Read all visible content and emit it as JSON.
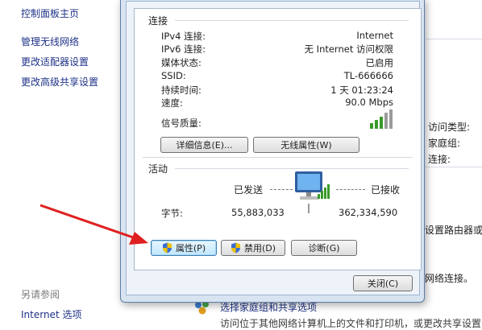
{
  "control_panel": {
    "home_link": "控制面板主页",
    "left_links": [
      "管理无线网络",
      "更改适配器设置",
      "更改高级共享设置"
    ],
    "see_also_title": "另请参阅",
    "internet_options": "Internet 选项",
    "right_labels": [
      "访问类型:",
      "家庭组:",
      "连接:"
    ],
    "router_text": "设置路由器或",
    "network_text": "网络连接。",
    "homegroup_link": "选择家庭组和共享选项",
    "bottom_text": "访问位于其他网络计算机上的文件和打印机，或更改共享设置"
  },
  "dialog": {
    "connection_group": "连接",
    "rows": [
      {
        "label": "IPv4 连接:",
        "value": "Internet"
      },
      {
        "label": "IPv6 连接:",
        "value": "无 Internet 访问权限"
      },
      {
        "label": "媒体状态:",
        "value": "已启用"
      },
      {
        "label": "SSID:",
        "value": "TL-666666"
      },
      {
        "label": "持续时间:",
        "value": "1 天 01:23:24"
      },
      {
        "label": "速度:",
        "value": "90.0 Mbps"
      }
    ],
    "signal_label": "信号质量:",
    "details_button": "详细信息(E)...",
    "wireless_props_button": "无线属性(W)",
    "activity_group": "活动",
    "sent_label": "已发送",
    "received_label": "已接收",
    "bytes_label": "字节:",
    "bytes_sent": "55,883,033",
    "bytes_received": "362,334,590",
    "properties_button": "属性(P)",
    "disable_button": "禁用(D)",
    "diagnose_button": "诊断(G)",
    "close_button": "关闭(C)"
  }
}
